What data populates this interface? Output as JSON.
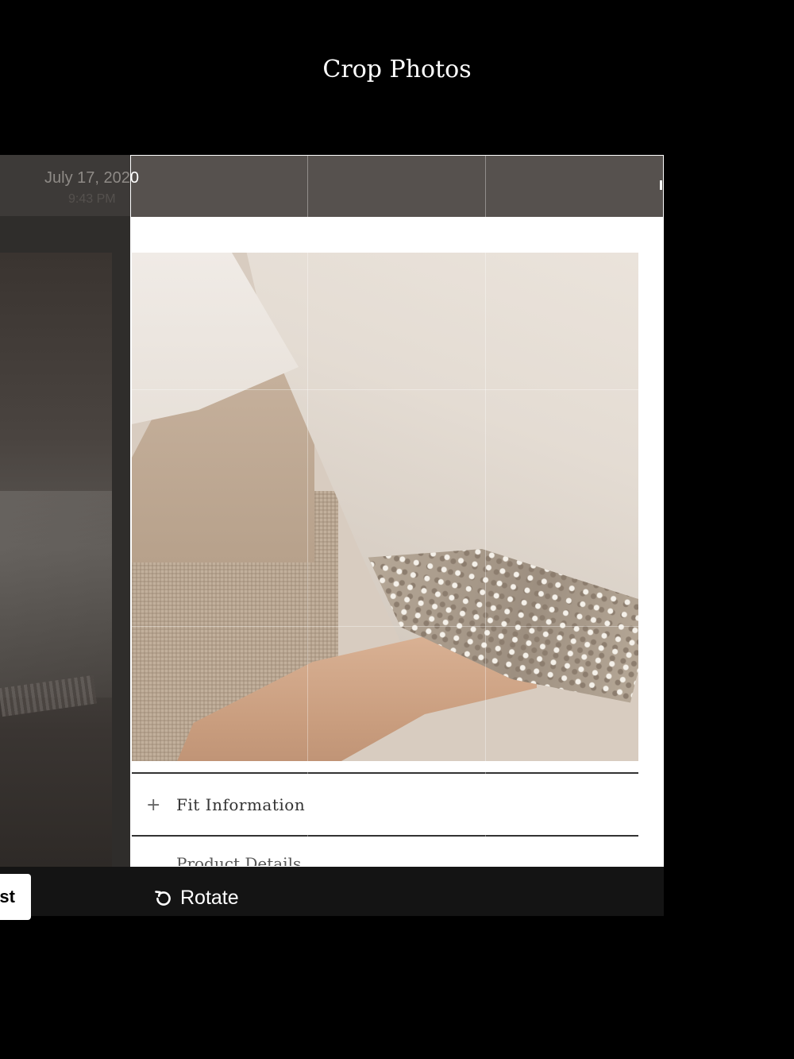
{
  "header": {
    "title": "Crop Photos"
  },
  "underlay": {
    "date": "July 17, 2020",
    "time": "9:43 PM"
  },
  "product": {
    "accordion_plus": "+",
    "fit_label": "Fit Information",
    "details_label": "Product Details"
  },
  "toolbar": {
    "adjust_label": "Adjust",
    "rotate_label": "Rotate"
  }
}
